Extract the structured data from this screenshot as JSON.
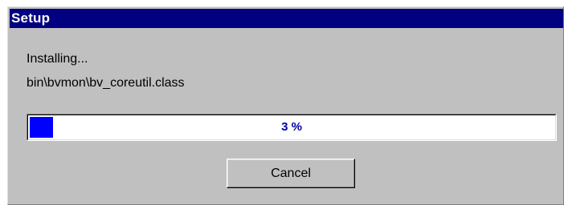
{
  "window": {
    "title": "Setup"
  },
  "status": {
    "action": "Installing...",
    "current_file": "bin\\bvmon\\bv_coreutil.class"
  },
  "progress": {
    "percent": 3,
    "label": "3 %"
  },
  "buttons": {
    "cancel_label": "Cancel"
  },
  "colors": {
    "titlebar": "#000080",
    "window_bg": "#c0c0c0",
    "progress_fill": "#0000ff",
    "progress_text": "#0000a8"
  }
}
